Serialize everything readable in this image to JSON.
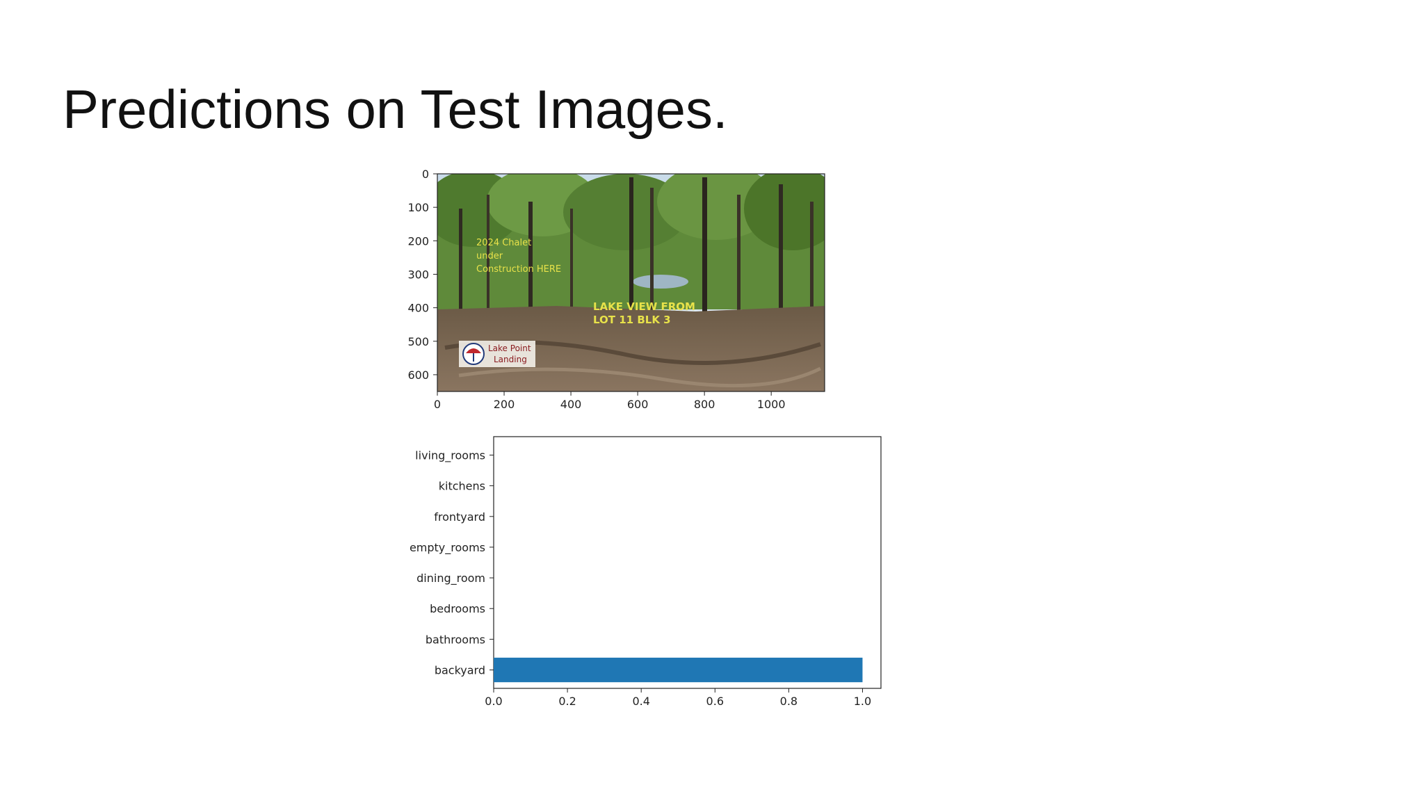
{
  "slide": {
    "title": "Predictions on Test Images."
  },
  "image_panel": {
    "description_icon": "photo-lake-lot",
    "photo_text": {
      "chalet_line1": "2024 Chalet",
      "chalet_line2": "under",
      "chalet_line3": "Construction HERE",
      "lake_line1": "LAKE VIEW FROM",
      "lake_line2": "LOT 11 BLK 3",
      "logo_line1": "Lake Point",
      "logo_line2": "Landing"
    },
    "x_ticks": [
      "0",
      "200",
      "400",
      "600",
      "800",
      "1000"
    ],
    "x_tick_values": [
      0,
      200,
      400,
      600,
      800,
      1000
    ],
    "y_ticks": [
      "0",
      "100",
      "200",
      "300",
      "400",
      "500",
      "600"
    ],
    "y_tick_values": [
      0,
      100,
      200,
      300,
      400,
      500,
      600
    ],
    "xlim": [
      0,
      1160
    ],
    "ylim": [
      650,
      0
    ]
  },
  "chart_data": {
    "type": "bar",
    "orientation": "horizontal",
    "title": "",
    "xlabel": "",
    "ylabel": "",
    "categories": [
      "backyard",
      "bathrooms",
      "bedrooms",
      "dining_room",
      "empty_rooms",
      "frontyard",
      "kitchens",
      "living_rooms"
    ],
    "values": [
      1.0,
      0.0,
      0.0,
      0.0,
      0.0,
      0.0,
      0.0,
      0.0
    ],
    "xlim": [
      0,
      1.05
    ],
    "x_ticks": [
      "0.0",
      "0.2",
      "0.4",
      "0.6",
      "0.8",
      "1.0"
    ],
    "x_tick_values": [
      0.0,
      0.2,
      0.4,
      0.6,
      0.8,
      1.0
    ],
    "bar_color": "#1f77b4",
    "grid": false,
    "legend": "none"
  }
}
